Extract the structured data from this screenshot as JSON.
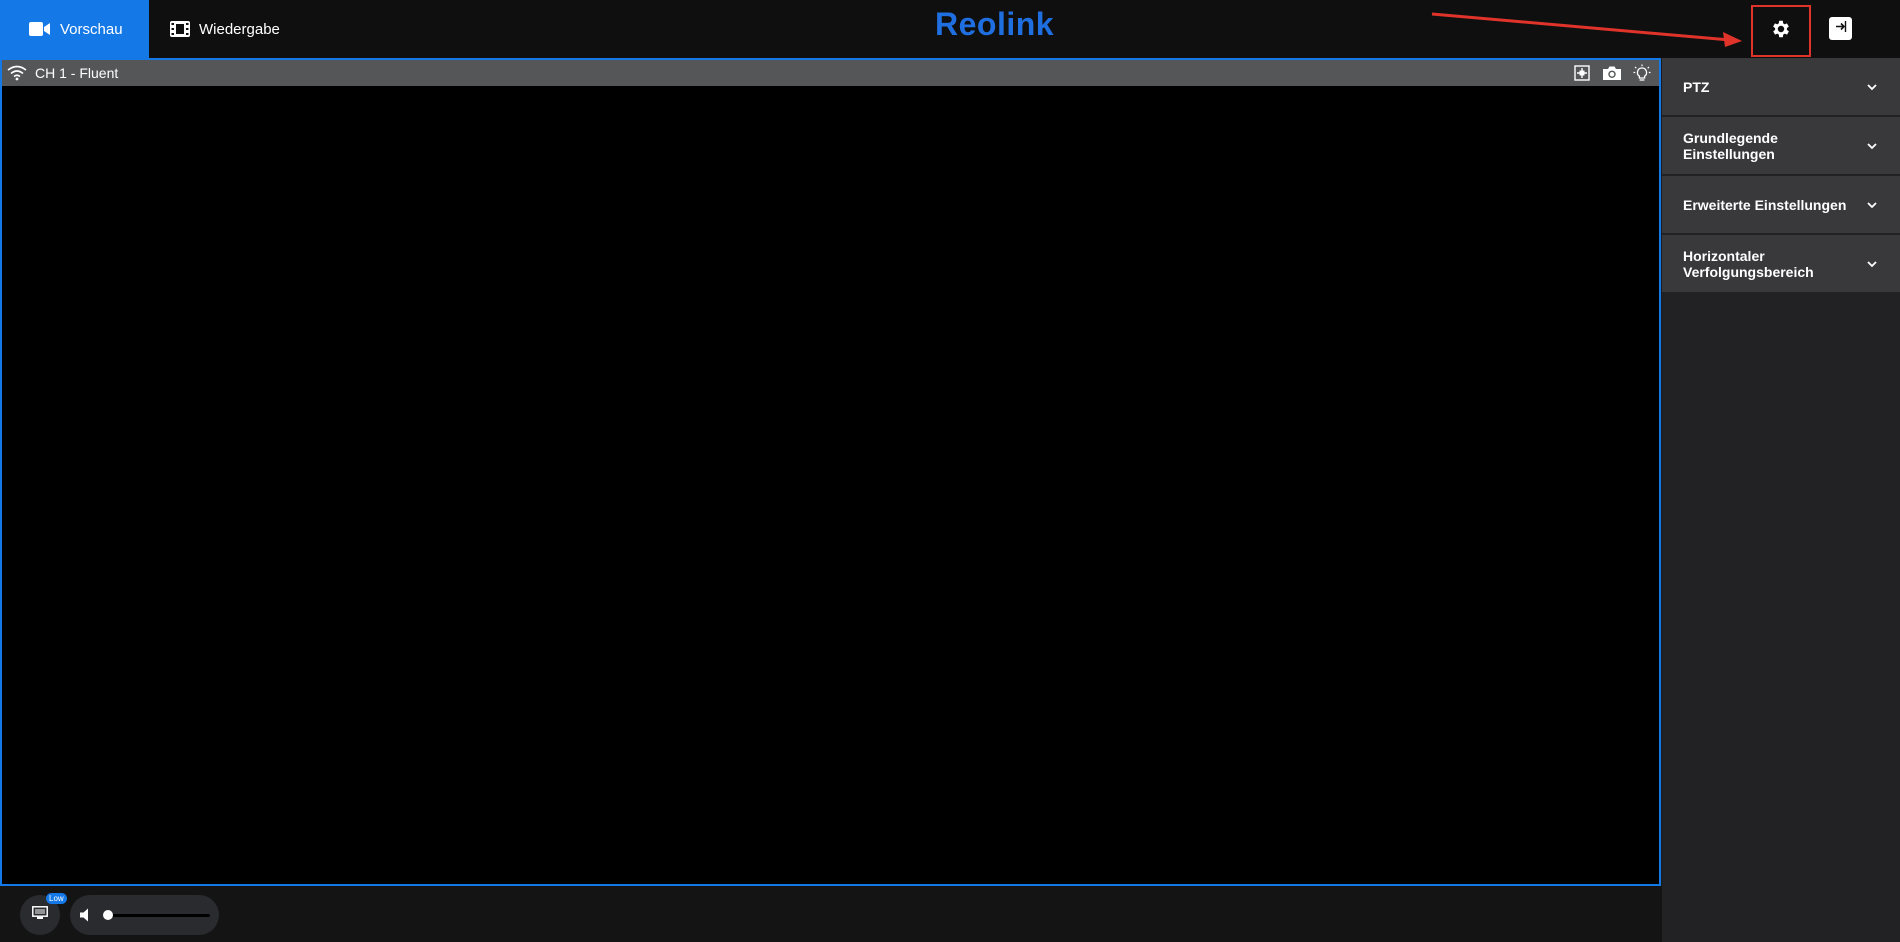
{
  "header": {
    "tabs": [
      {
        "label": "Vorschau",
        "icon": "video-camera-icon",
        "active": true
      },
      {
        "label": "Wiedergabe",
        "icon": "film-icon",
        "active": false
      }
    ],
    "logo_text": "Reolink",
    "icons": {
      "settings": "gear-icon",
      "logout": "logout-icon"
    }
  },
  "video": {
    "channel_title": "CH 1 - Fluent",
    "icons": [
      "wifi-icon",
      "zoom-icon",
      "snapshot-icon",
      "light-icon"
    ]
  },
  "bottom": {
    "stream_badge": "Low",
    "volume_level": 0
  },
  "sidepanel": {
    "sections": [
      {
        "label": "PTZ"
      },
      {
        "label": "Grundlegende Einstellungen"
      },
      {
        "label": "Erweiterte Einstellungen"
      },
      {
        "label": "Horizontaler Verfolgungsbereich"
      }
    ]
  },
  "colors": {
    "accent": "#1478e6",
    "highlight": "#e0332a",
    "logo": "#1f6fe0"
  }
}
